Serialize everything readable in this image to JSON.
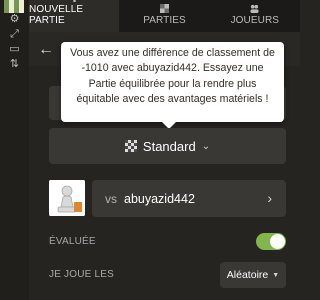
{
  "nav": {
    "tabs": [
      {
        "label": "NOUVELLE PARTIE",
        "icon": "plus-square-icon",
        "active": true
      },
      {
        "label": "PARTIES",
        "icon": "board-grid-icon",
        "active": false
      },
      {
        "label": "JOUEURS",
        "icon": "players-icon",
        "active": false
      }
    ]
  },
  "rail": {
    "icons": [
      "chessboard-thumbnail-icon",
      "settings-gear-icon",
      "expand-icon",
      "flip-board-icon",
      "share-icon"
    ]
  },
  "tooltip": {
    "text": "Vous avez une différence de classement de -1010 avec abuyazid442. Essayez une Partie équilibrée pour la rendre plus équitable avec des avantages matériels !"
  },
  "game_type": {
    "label": "Standard",
    "icon": "checkered-board-icon"
  },
  "opponent": {
    "prefix": "vs",
    "name": "abuyazid442"
  },
  "rated": {
    "label": "ÉVALUÉE",
    "enabled": true
  },
  "play_as": {
    "label": "JE JOUE LES",
    "value": "Aléatoire"
  },
  "colors": {
    "background": "#262421",
    "button": "#3a3835",
    "toggle_on": "#81b64c",
    "tooltip_bg": "#ffffff"
  }
}
